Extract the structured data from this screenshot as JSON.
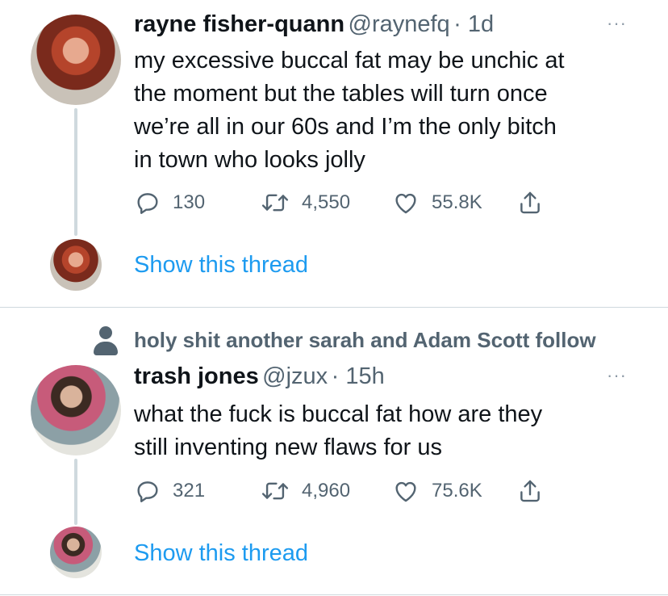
{
  "tweets": [
    {
      "author_name": "rayne fisher-quann",
      "handle": "@raynefq",
      "time": "· 1d",
      "text_lines": [
        "my excessive buccal fat may be unchic at",
        "the moment but the tables will turn once",
        "we’re all in our 60s and I’m the only bitch",
        "in town who looks jolly"
      ],
      "replies": "130",
      "retweets": "4,550",
      "likes": "55.8K",
      "more_glyph": "···",
      "show_thread": "Show this thread"
    },
    {
      "social_context": "holy shit another sarah and Adam Scott follow",
      "author_name": "trash jones",
      "handle": "@jzux",
      "time": "· 15h",
      "text_lines": [
        "what the fuck is buccal fat how are they",
        "still inventing new flaws for us"
      ],
      "replies": "321",
      "retweets": "4,960",
      "likes": "75.6K",
      "more_glyph": "···",
      "show_thread": "Show this thread"
    }
  ],
  "icons": [
    "reply-icon",
    "retweet-icon",
    "like-icon",
    "share-icon",
    "person-icon",
    "more-icon"
  ],
  "colors": {
    "text": "#0f1419",
    "secondary": "#536471",
    "link": "#1d9bf0",
    "line": "#cfd9de"
  }
}
